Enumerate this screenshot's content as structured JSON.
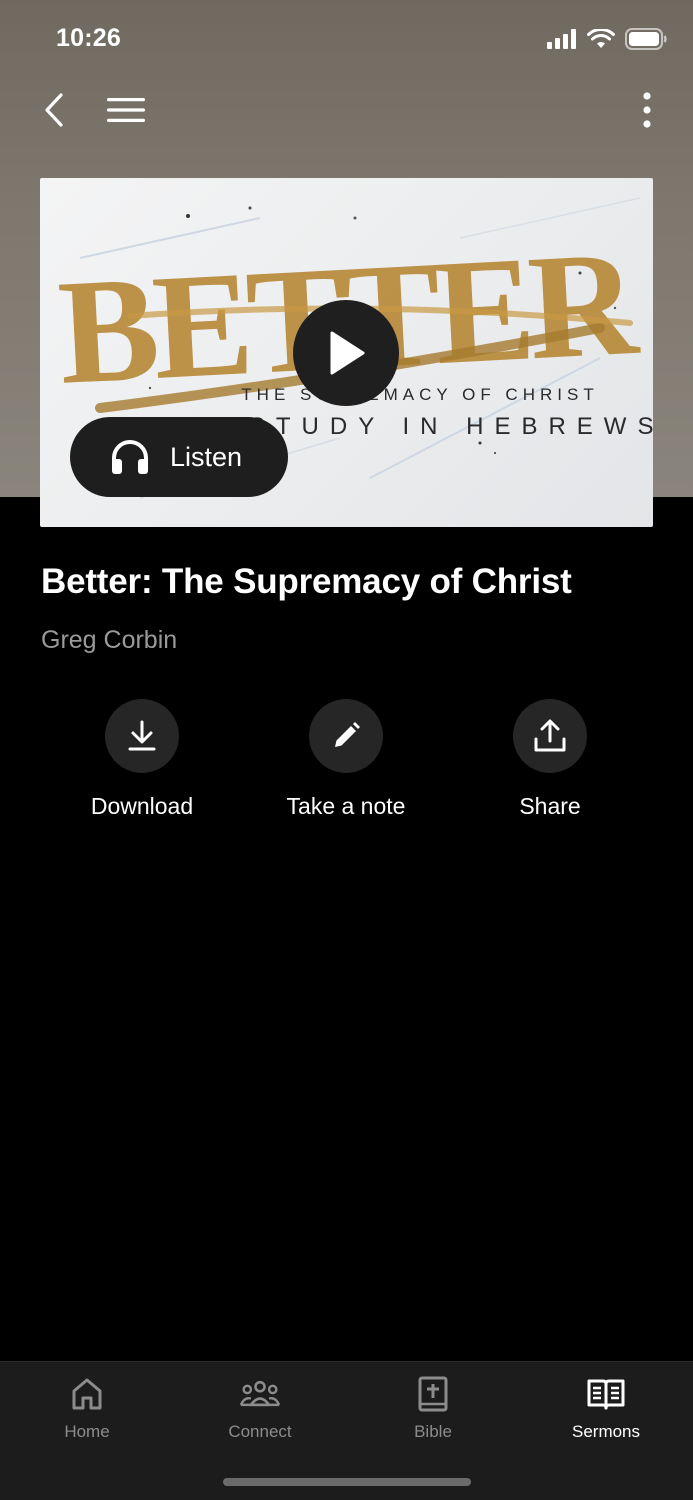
{
  "status_bar": {
    "time": "10:26"
  },
  "artwork": {
    "title_word": "BETTER",
    "subtitle_line1": "THE SUPREMACY OF CHRIST",
    "subtitle_line2": "A STUDY IN HEBREWS",
    "listen_label": "Listen"
  },
  "sermon": {
    "title": "Better: The Supremacy of Christ",
    "speaker": "Greg Corbin"
  },
  "actions": [
    {
      "label": "Download",
      "icon": "download-icon"
    },
    {
      "label": "Take a note",
      "icon": "pencil-icon"
    },
    {
      "label": "Share",
      "icon": "share-icon"
    }
  ],
  "tab_bar": {
    "tabs": [
      {
        "label": "Home",
        "icon": "home-icon"
      },
      {
        "label": "Connect",
        "icon": "people-icon"
      },
      {
        "label": "Bible",
        "icon": "bible-icon"
      },
      {
        "label": "Sermons",
        "icon": "open-book-icon"
      }
    ],
    "active": "Sermons"
  },
  "colors": {
    "header_background": "#7a7469",
    "page_background": "#000000",
    "tab_bar_background": "#1c1c1d",
    "art_gold": "#b88a3a"
  }
}
